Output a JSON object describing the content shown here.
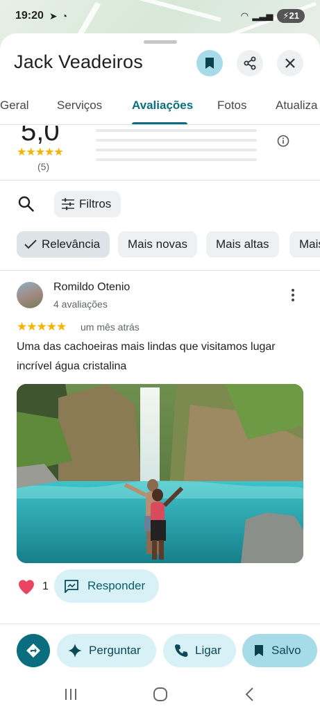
{
  "status_bar": {
    "time": "19:20",
    "battery": "21"
  },
  "place": {
    "name": "Jack Veadeiros"
  },
  "tabs": [
    {
      "label": "Geral"
    },
    {
      "label": "Serviços"
    },
    {
      "label": "Avaliações"
    },
    {
      "label": "Fotos"
    },
    {
      "label": "Atualiza"
    }
  ],
  "rating_summary": {
    "score": "5,0",
    "stars": "★★★★★",
    "count": "(5)"
  },
  "filters": {
    "filter_label": "Filtros",
    "sort_options": [
      "Relevância",
      "Mais novas",
      "Mais altas",
      "Mais"
    ]
  },
  "review": {
    "author": "Romildo Otenio",
    "author_meta": "4 avaliações",
    "stars": "★★★★★",
    "date": "um mês atrás",
    "text": "Uma das cachoeiras mais lindas que visitamos lugar incrível água cristalina",
    "likes": "1",
    "reply_label": "Responder"
  },
  "actions": {
    "ask": "Perguntar",
    "call": "Ligar",
    "saved": "Salvo"
  },
  "colors": {
    "accent": "#0b6e7e",
    "pill_bg": "#d8f1f6",
    "star": "#f4b400"
  }
}
